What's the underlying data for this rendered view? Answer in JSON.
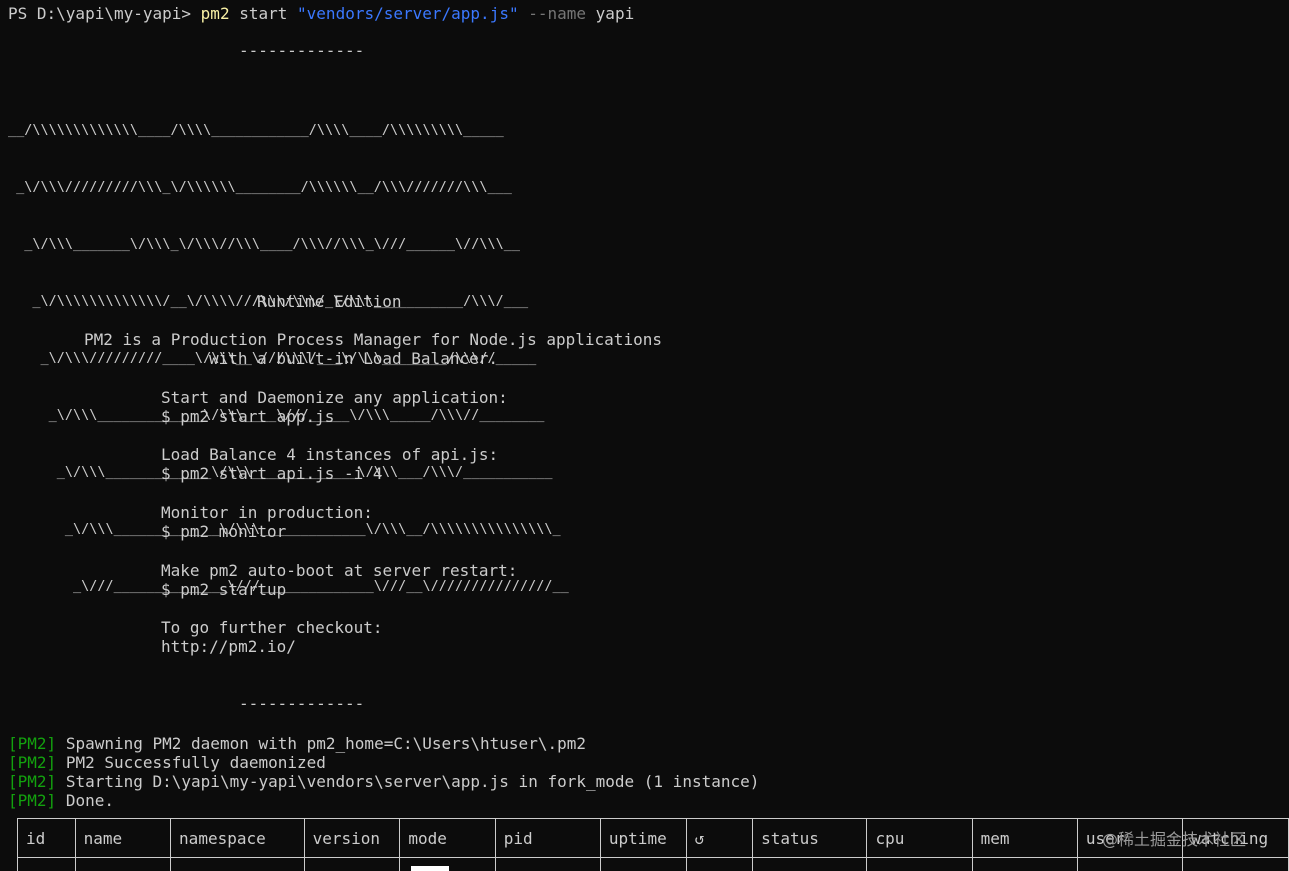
{
  "prompt": {
    "ps_prefix": "PS D:\\yapi\\my-yapi>",
    "command": "pm2",
    "sub": "start",
    "path_arg": "\"vendors/server/app.js\"",
    "flag": "--name",
    "flag_value": "yapi"
  },
  "banner": {
    "rule_top": "-------------",
    "ascii_art": [
      "__/\\\\\\\\\\\\\\\\\\\\\\\\\\____/\\\\\\\\____________/\\\\\\\\____/\\\\\\\\\\\\\\\\\\_____",
      " _\\/\\\\\\/////////\\\\\\_\\/\\\\\\\\\\\\________/\\\\\\\\\\\\__/\\\\\\///////\\\\\\___",
      "  _\\/\\\\\\_______\\/\\\\\\_\\/\\\\\\//\\\\\\____/\\\\\\//\\\\\\_\\///______\\//\\\\\\__",
      "   _\\/\\\\\\\\\\\\\\\\\\\\\\\\\\/__\\/\\\\\\\\///\\\\\\/\\\\\\/_\\/\\\\\\___________/\\\\\\/___",
      "    _\\/\\\\\\/////////____\\/\\\\\\__\\///\\\\\\/___\\/\\\\\\________/\\\\\\//_____",
      "     _\\/\\\\\\_____________\\/\\\\\\____\\///_____\\/\\\\\\_____/\\\\\\//________",
      "      _\\/\\\\\\_____________\\/\\\\\\_____________\\/\\\\\\___/\\\\\\/___________",
      "       _\\/\\\\\\_____________\\/\\\\\\_____________\\/\\\\\\__/\\\\\\\\\\\\\\\\\\\\\\\\\\\\\\_",
      "        _\\///______________\\///______________\\///__\\///////////////__"
    ],
    "edition": "Runtime Edition",
    "desc_1": "PM2 is a Production Process Manager for Node.js applications",
    "desc_2": "with a built-in Load Balancer.",
    "tips": [
      {
        "title": "Start and Daemonize any application:",
        "cmd": "$ pm2 start app.js"
      },
      {
        "title": "Load Balance 4 instances of api.js:",
        "cmd": "$ pm2 start api.js -i 4"
      },
      {
        "title": "Monitor in production:",
        "cmd": "$ pm2 monitor"
      },
      {
        "title": "Make pm2 auto-boot at server restart:",
        "cmd": "$ pm2 startup"
      },
      {
        "title": "To go further checkout:",
        "cmd": "http://pm2.io/"
      }
    ],
    "rule_bottom": "-------------"
  },
  "log": {
    "tag": "[PM2]",
    "messages": [
      "Spawning PM2 daemon with pm2_home=C:\\Users\\htuser\\.pm2",
      "PM2 Successfully daemonized",
      "Starting D:\\yapi\\my-yapi\\vendors\\server\\app.js in fork_mode (1 instance)",
      "Done."
    ]
  },
  "table": {
    "headers": [
      "id",
      "name",
      "namespace",
      "version",
      "mode",
      "pid",
      "uptime",
      "↺",
      "status",
      "cpu",
      "mem",
      "user",
      "watching"
    ]
  },
  "watermark": "@稀土掘金技术社区",
  "colors": {
    "background": "#0c0c0c",
    "text": "#cccccc",
    "command": "#f9f1a5",
    "string": "#3b78ff",
    "flag": "#767676",
    "tag": "#13a10e"
  }
}
